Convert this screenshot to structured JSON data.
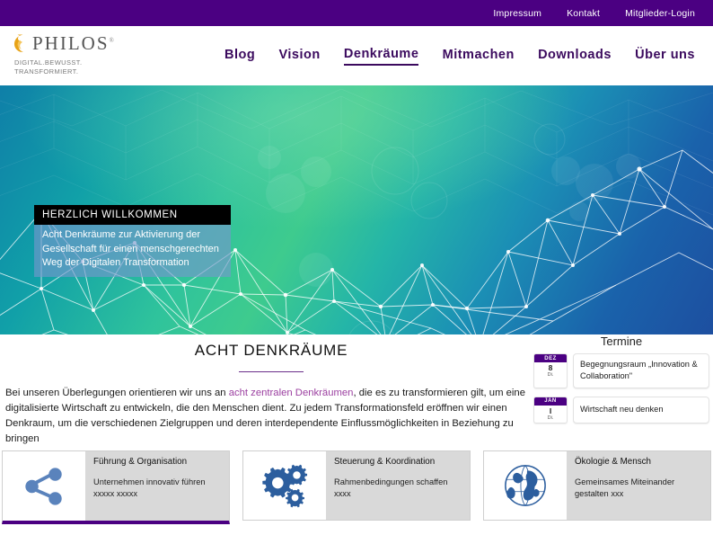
{
  "topbar": {
    "links": [
      {
        "label": "Impressum"
      },
      {
        "label": "Kontakt"
      },
      {
        "label": "Mitglieder-Login"
      }
    ]
  },
  "brand": {
    "name": "PHILOS",
    "trademark": "®",
    "tagline_line1": "DIGITAL.BEWUSST.",
    "tagline_line2": "TRANSFORMIERT.",
    "mark_color": "#E8A317",
    "word_color": "#555555"
  },
  "mainnav": {
    "items": [
      {
        "label": "Blog",
        "active": false
      },
      {
        "label": "Vision",
        "active": false
      },
      {
        "label": "Denkräume",
        "active": true
      },
      {
        "label": "Mitmachen",
        "active": false
      },
      {
        "label": "Downloads",
        "active": false
      },
      {
        "label": "Über uns",
        "active": false
      }
    ],
    "color": "#3B0A5E"
  },
  "hero": {
    "badge": "HERZLICH WILLKOMMEN",
    "subtitle": "Acht Denkräume zur Aktivierung der Gesellschaft für einen menschgerechten Weg der Digitalen Transformation"
  },
  "main": {
    "title": "ACHT DENKRÄUME",
    "intro_part1": "Bei unseren Überlegungen orientieren wir uns an ",
    "intro_highlight": "acht zentralen Denkräumen",
    "intro_part2": ", die es zu transformieren gilt, um eine digitalisierte Wirtschaft zu entwickeln, die den Menschen dient. Zu jedem Transformationsfeld eröffnen wir einen Denkraum, um die verschiedenen Zielgruppen und deren interdependente Einflussmöglichkeiten in Beziehung zu bringen",
    "accent_color": "#9B3FA0"
  },
  "termine": {
    "heading": "Termine",
    "events": [
      {
        "month": "DEZ",
        "day": "8",
        "weekday": "Di.",
        "title": "Begegnungsraum „Innovation & Collaboration\""
      },
      {
        "month": "JAN",
        "day": "I",
        "weekday": "Di.",
        "title": "Wirtschaft neu denken"
      }
    ],
    "chip_color": "#4B0082"
  },
  "tiles": [
    {
      "icon": "share-nodes-icon",
      "title": "Führung & Organisation",
      "desc": "Unternehmen innovativ führen xxxxx xxxxx",
      "accent": true
    },
    {
      "icon": "gears-icon",
      "title": "Steuerung & Koordination",
      "desc": "Rahmenbedingungen schaffen xxxx",
      "accent": false
    },
    {
      "icon": "globe-icon",
      "title": "Ökologie & Mensch",
      "desc": "Gemeinsames Miteinander gestalten xxx",
      "accent": false
    }
  ]
}
